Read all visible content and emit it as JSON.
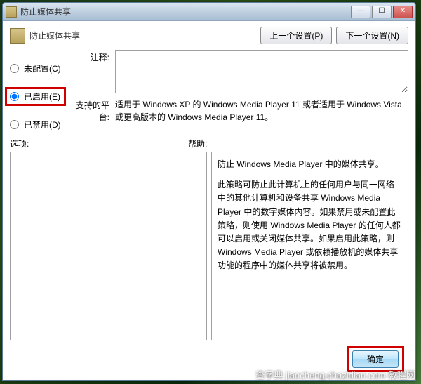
{
  "window": {
    "title": "防止媒体共享"
  },
  "header": {
    "title": "防止媒体共享",
    "prev_btn": "上一个设置(P)",
    "next_btn": "下一个设置(N)"
  },
  "radios": {
    "not_configured": "未配置(C)",
    "enabled": "已启用(E)",
    "disabled": "已禁用(D)"
  },
  "fields": {
    "comment_label": "注释:",
    "platform_label": "支持的平台:",
    "platform_text": "适用于 Windows XP 的 Windows Media Player 11 或者适用于 Windows Vista 或更高版本的 Windows Media Player 11。"
  },
  "labels": {
    "options": "选项:",
    "help": "帮助:"
  },
  "help": {
    "p1": "防止 Windows Media Player 中的媒体共享。",
    "p2": "此策略可防止此计算机上的任何用户与同一网络中的其他计算机和设备共享 Windows Media Player 中的数字媒体内容。如果禁用或未配置此策略，则使用 Windows Media Player 的任何人都可以启用或关闭媒体共享。如果启用此策略，则 Windows Media Player 或依赖播放机的媒体共享功能的程序中的媒体共享将被禁用。"
  },
  "footer": {
    "ok": "确定"
  },
  "watermark": "查字典  jiaocheng.chazidian.com  教程网"
}
